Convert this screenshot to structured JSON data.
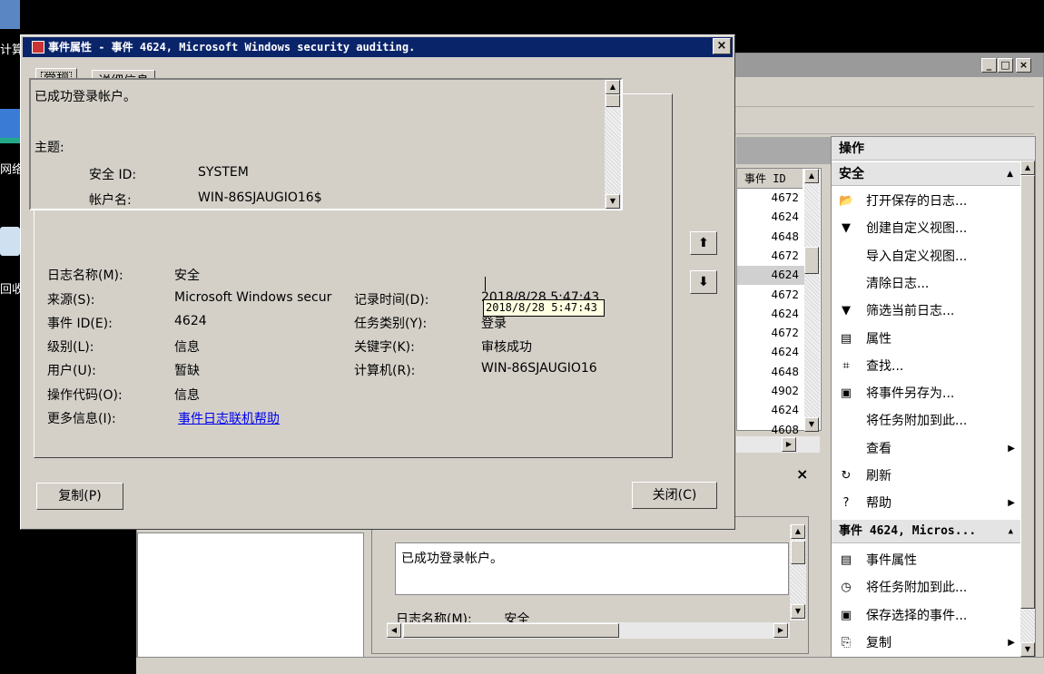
{
  "desktop": {
    "labels": [
      "计算",
      "网络",
      "回收"
    ]
  },
  "event_viewer": {
    "list_header": "事件 ID",
    "event_ids": [
      "4672",
      "4624",
      "4648",
      "4672",
      "4624",
      "4672",
      "4624",
      "4672",
      "4624",
      "4648",
      "4902",
      "4624",
      "4608"
    ],
    "actions": {
      "section1": "操作",
      "section2": "安全",
      "items": [
        {
          "icon": "folder-open-icon",
          "glyph": "📂",
          "label": "打开保存的日志..."
        },
        {
          "icon": "filter-icon",
          "glyph": "▼",
          "label": "创建自定义视图..."
        },
        {
          "icon": "",
          "glyph": "",
          "label": "导入自定义视图..."
        },
        {
          "icon": "",
          "glyph": "",
          "label": "清除日志..."
        },
        {
          "icon": "filter-icon",
          "glyph": "▼",
          "label": "筛选当前日志..."
        },
        {
          "icon": "properties-icon",
          "glyph": "▤",
          "label": "属性"
        },
        {
          "icon": "binoculars-icon",
          "glyph": "⌗",
          "label": "查找..."
        },
        {
          "icon": "save-icon",
          "glyph": "▣",
          "label": "将事件另存为..."
        },
        {
          "icon": "",
          "glyph": "",
          "label": "将任务附加到此..."
        },
        {
          "icon": "",
          "glyph": "",
          "label": "查看",
          "submenu": true
        },
        {
          "icon": "refresh-icon",
          "glyph": "↻",
          "label": "刷新"
        },
        {
          "icon": "help-icon",
          "glyph": "?",
          "label": "帮助",
          "submenu": true
        }
      ],
      "section3": "事件 4624, Micros...",
      "items2": [
        {
          "icon": "properties-icon",
          "glyph": "▤",
          "label": "事件属性"
        },
        {
          "icon": "task-icon",
          "glyph": "◷",
          "label": "将任务附加到此..."
        },
        {
          "icon": "save-icon",
          "glyph": "▣",
          "label": "保存选择的事件..."
        },
        {
          "icon": "copy-icon",
          "glyph": "⎘",
          "label": "复制",
          "submenu": true
        }
      ]
    },
    "preview_text": "已成功登录帐户。",
    "preview_partial": "日志名称(M):        安全"
  },
  "dialog": {
    "title": "事件属性 - 事件 4624, Microsoft Windows security auditing.",
    "tabs": [
      "常规",
      "详细信息"
    ],
    "description": {
      "line1": "已成功登录帐户。",
      "subject": "主题:",
      "sid_label": "安全 ID:",
      "sid_value": "SYSTEM",
      "account_label": "帐户名:",
      "account_value": "WIN-86SJAUGIO16$"
    },
    "fields": {
      "log_name_label": "日志名称(M):",
      "log_name_value": "安全",
      "source_label": "来源(S):",
      "source_value": "Microsoft Windows secur",
      "logged_label": "记录时间(D):",
      "logged_value": "2018/8/28 5:47:43",
      "event_id_label": "事件 ID(E):",
      "event_id_value": "4624",
      "task_label": "任务类别(Y):",
      "task_value": "登录",
      "level_label": "级别(L):",
      "level_value": "信息",
      "keywords_label": "关键字(K):",
      "keywords_value": "审核成功",
      "user_label": "用户(U):",
      "user_value": "暂缺",
      "computer_label": "计算机(R):",
      "computer_value": "WIN-86SJAUGIO16",
      "opcode_label": "操作代码(O):",
      "opcode_value": "信息",
      "more_info_label": "更多信息(I):",
      "more_info_link": "事件日志联机帮助"
    },
    "tooltip": "2018/8/28 5:47:43",
    "copy_button": "复制(P)",
    "close_button": "关闭(C)"
  }
}
